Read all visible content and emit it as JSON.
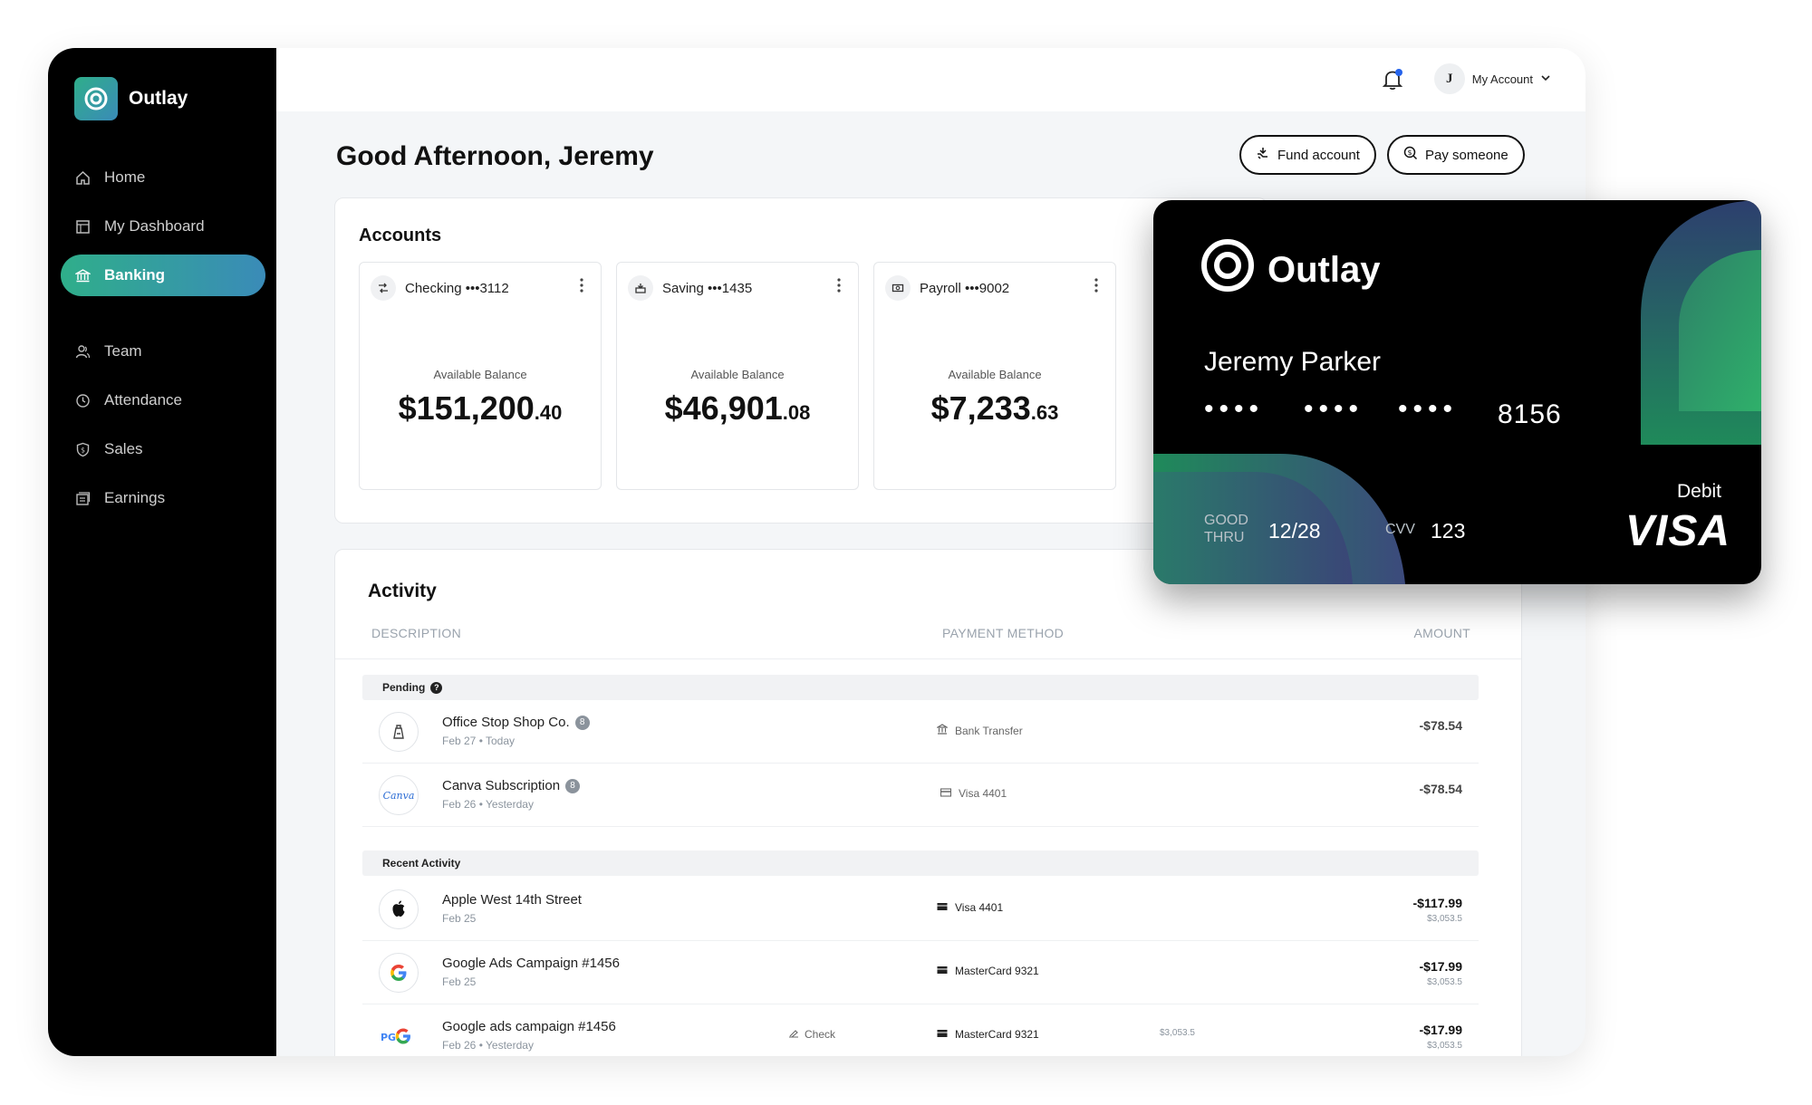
{
  "app": {
    "name": "Outlay"
  },
  "sidebar": {
    "items": [
      {
        "label": "Home",
        "icon": "home-icon"
      },
      {
        "label": "My Dashboard",
        "icon": "dashboard-icon"
      },
      {
        "label": "Banking",
        "icon": "bank-icon",
        "active": true
      },
      {
        "label": "Team",
        "icon": "team-icon"
      },
      {
        "label": "Attendance",
        "icon": "clock-icon"
      },
      {
        "label": "Sales",
        "icon": "sales-icon"
      },
      {
        "label": "Earnings",
        "icon": "earnings-icon"
      }
    ]
  },
  "topbar": {
    "account_initial": "J",
    "account_label": "My Account"
  },
  "header": {
    "greeting": "Good Afternoon, Jeremy",
    "fund_label": "Fund account",
    "pay_label": "Pay someone"
  },
  "accounts": {
    "title": "Accounts",
    "balance_label": "Available Balance",
    "items": [
      {
        "name": "Checking •••3112",
        "dollars": "$151,200",
        "cents": ".40"
      },
      {
        "name": "Saving •••1435",
        "dollars": "$46,901",
        "cents": ".08"
      },
      {
        "name": "Payroll •••9002",
        "dollars": "$7,233",
        "cents": ".63"
      }
    ]
  },
  "activity": {
    "title": "Activity",
    "columns": {
      "description": "DESCRIPTION",
      "payment": "PAYMENT METHOD",
      "amount": "AMOUNT"
    },
    "pending_label": "Pending",
    "recent_label": "Recent Activity",
    "pending": [
      {
        "name": "Office Stop Shop Co.",
        "date": "Feb 27 • Today",
        "method": "Bank Transfer",
        "amount": "-$78.54",
        "badge": "8"
      },
      {
        "name": "Canva Subscription",
        "date": "Feb 26 • Yesterday",
        "method": "Visa 4401",
        "amount": "-$78.54",
        "badge": "8",
        "logo_text": "Canva"
      }
    ],
    "recent": [
      {
        "name": "Apple West 14th Street",
        "date": "Feb 25",
        "method": "Visa 4401",
        "amount": "-$117.99",
        "sub": "$3,053.5"
      },
      {
        "name": "Google Ads Campaign #1456",
        "date": "Feb 25",
        "method": "MasterCard 9321",
        "amount": "-$17.99",
        "sub": "$3,053.5"
      },
      {
        "name": "Google ads campaign #1456",
        "date": "Feb 26 • Yesterday",
        "check": "Check",
        "method": "MasterCard 9321",
        "extra": "$3,053.5",
        "amount": "-$17.99",
        "sub": "$3,053.5"
      }
    ]
  },
  "card": {
    "brand": "Outlay",
    "holder": "Jeremy Parker",
    "dots": "••••",
    "last4": "8156",
    "good_thru_label1": "GOOD",
    "good_thru_label2": "THRU",
    "expiry": "12/28",
    "cvv_label": "CVV",
    "cvv": "123",
    "type": "Debit",
    "network": "VISA"
  },
  "colors": {
    "accent_start": "#2fae8a",
    "accent_end": "#3a8bb8",
    "notification_dot": "#2563eb"
  }
}
